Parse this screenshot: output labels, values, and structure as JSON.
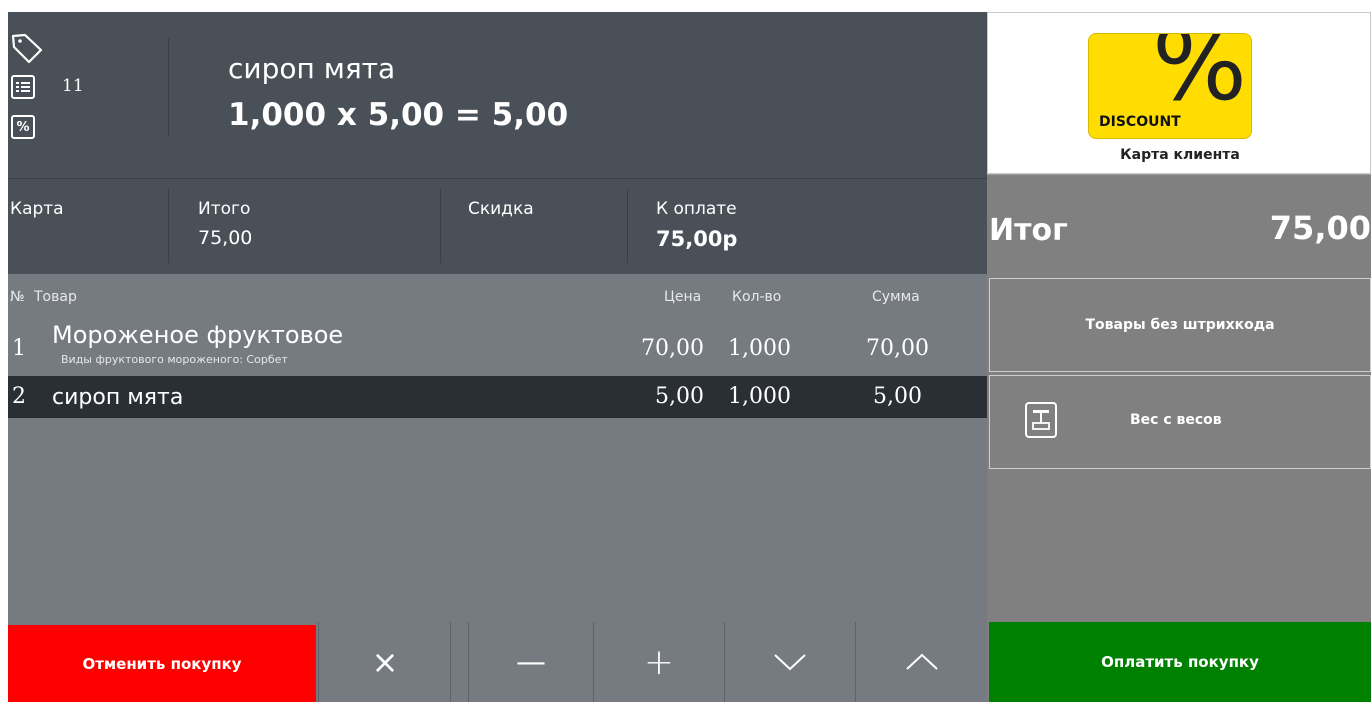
{
  "header": {
    "counter": "11",
    "product_name": "сироп мята",
    "product_calc": "1,000 x 5,00 = 5,00"
  },
  "totals": {
    "card_label": "Карта",
    "total_label": "Итого",
    "total_value": "75,00",
    "discount_label": "Скидка",
    "to_pay_label": "К оплате",
    "to_pay_value": "75,00р"
  },
  "table": {
    "headers": {
      "num": "№",
      "product": "Товар",
      "price": "Цена",
      "qty": "Кол-во",
      "sum": "Сумма"
    },
    "rows": [
      {
        "num": "1",
        "name": "Мороженое фруктовое",
        "note": "Виды фруктового мороженого: Сорбет",
        "price": "70,00",
        "qty": "1,000",
        "sum": "70,00"
      },
      {
        "num": "2",
        "name": "сироп мята",
        "note": "",
        "price": "5,00",
        "qty": "1,000",
        "sum": "5,00"
      }
    ]
  },
  "bottom": {
    "cancel_label": "Отменить покупку",
    "delete_symbol": "×",
    "minus_symbol": "—",
    "plus_symbol": "+",
    "down_symbol": "﹀",
    "up_symbol": "︿"
  },
  "right": {
    "discount_text": "DISCOUNT",
    "percent_symbol": "%",
    "card_caption": "Карта клиента",
    "itog_label": "Итог",
    "itog_value": "75,00",
    "no_barcode_label": "Товары без штрихкода",
    "scale_label": "Вес с весов",
    "pay_label": "Оплатить покупку"
  },
  "colors": {
    "header_bg": "#4a5058",
    "table_bg": "#767a81",
    "selected_row_bg": "#2a2f36",
    "cancel": "#ff0000",
    "pay": "#008000",
    "panel": "#808080",
    "discount_card": "#ffdd00"
  },
  "icons": [
    "tag-icon",
    "list-icon",
    "percent-icon",
    "scale-icon"
  ]
}
